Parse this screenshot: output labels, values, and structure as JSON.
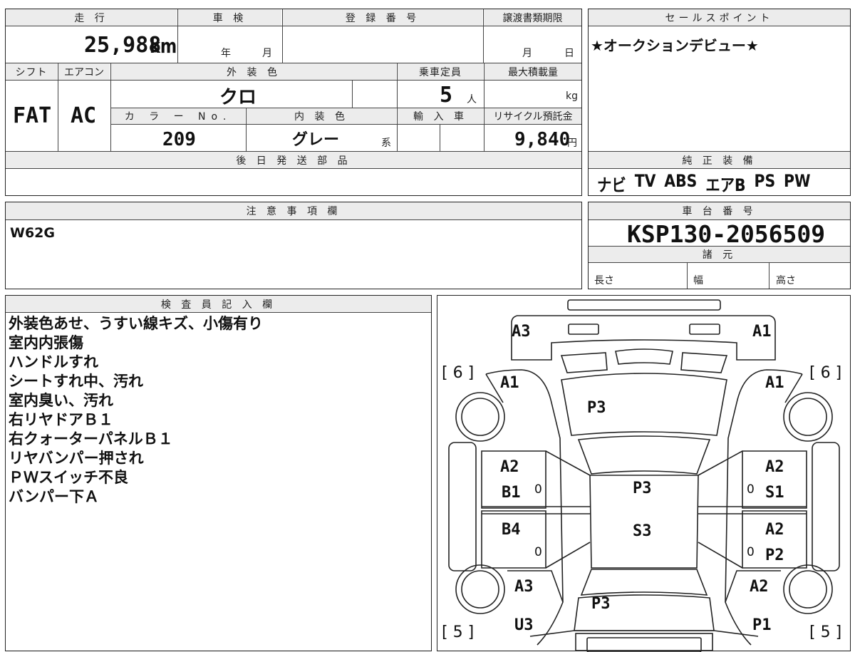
{
  "vehicle": {
    "mileage_header": "走 行",
    "mileage_value": "25,988",
    "mileage_unit": "km",
    "inspection_header": "車 検",
    "inspection_year_unit": "年",
    "inspection_month_unit": "月",
    "registration_header": "登 録 番 号",
    "transfer_deadline_header": "譲渡書類期限",
    "transfer_month_unit": "月",
    "transfer_day_unit": "日",
    "shift_header": "シフト",
    "shift_value": "FAT",
    "aircon_header": "エアコン",
    "aircon_value": "AC",
    "exterior_color_header": "外 装 色",
    "exterior_color_value": "クロ",
    "capacity_header": "乗車定員",
    "capacity_value": "5",
    "capacity_unit": "人",
    "max_load_header": "最大積載量",
    "max_load_unit": "kg",
    "color_no_header": "カ ラ ー No.",
    "color_no_value": "209",
    "interior_color_header": "内 装 色",
    "interior_color_value": "グレー",
    "interior_color_suffix": "系",
    "import_header": "輸 入 車",
    "recycle_fee_header": "リサイクル預託金",
    "recycle_fee_value": "9,840",
    "recycle_fee_unit": "円",
    "shipping_parts_header": "後 日 発 送 部 品"
  },
  "sales_point": {
    "header": "セールスポイント",
    "text": "★オークションデビュー★"
  },
  "genuine_equipment": {
    "header": "純 正 装 備",
    "items": [
      "ナビ",
      "TV",
      "ABS",
      "エアB",
      "PS",
      "PW"
    ]
  },
  "notes": {
    "header": "注 意 事 項 欄",
    "text": "W62G"
  },
  "chassis": {
    "header": "車 台 番 号",
    "value": "KSP130-2056509",
    "specs_header": "諸 元",
    "length_label": "長さ",
    "width_label": "幅",
    "height_label": "高さ"
  },
  "inspector": {
    "header": "検 査 員 記 入 欄",
    "lines": [
      "外装色あせ、うすい線キズ、小傷有り",
      "室内内張傷",
      "ハンドルすれ",
      "シートすれ中、汚れ",
      "室内臭い、汚れ",
      "右リヤドアＢ１",
      "右クォーターパネルＢ１",
      "リヤバンパー押され",
      "ＰＷスイッチ不良",
      "バンパー下Ａ"
    ]
  },
  "diagram": {
    "tire_front_left": "[ 6 ]",
    "tire_front_right": "[ 6 ]",
    "tire_rear_left": "[ 5 ]",
    "tire_rear_right": "[ 5 ]",
    "front_bumper_left": "A3",
    "front_bumper_right": "A1",
    "front_fender_left": "A1",
    "front_fender_right": "A1",
    "hood": "P3",
    "front_door_left_1": "A2",
    "front_door_left_2": "B1",
    "front_door_right_1": "A2",
    "front_door_right_2": "S1",
    "roof": "P3",
    "roof_2": "S3",
    "rear_door_left": "B4",
    "rear_door_right_1": "A2",
    "rear_door_right_2": "P2",
    "rear_fender_left": "A3",
    "rear_fender_right": "A2",
    "trunk": "P3",
    "rear_bumper_left": "U3",
    "rear_bumper_right": "P1",
    "zero_mark": "0"
  }
}
